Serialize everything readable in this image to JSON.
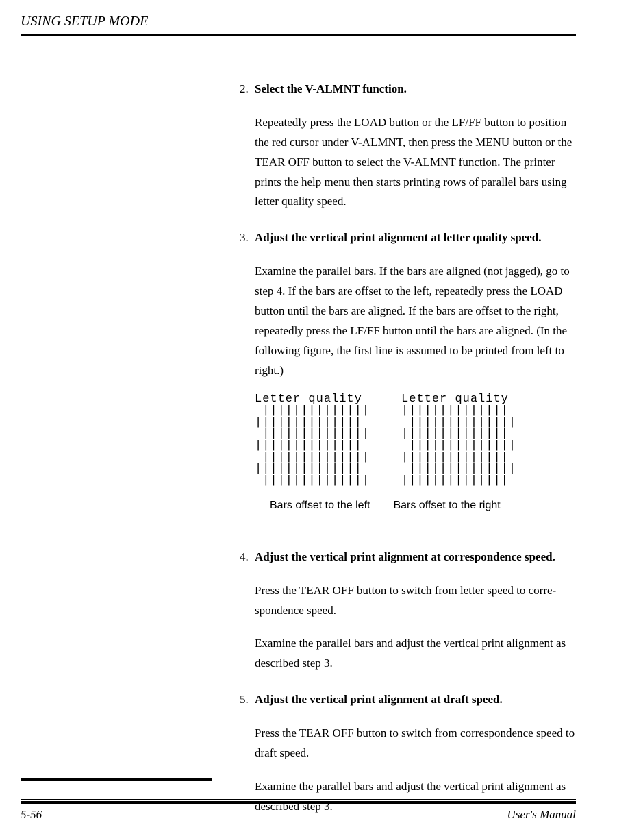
{
  "header": "USING SETUP MODE",
  "steps": [
    {
      "num": "2.",
      "title": "Select the V-ALMNT function.",
      "paras": [
        "Repeatedly press the LOAD button or the LF/FF button to position the red cursor under V-ALMNT, then press the MENU button or the TEAR OFF button to select the V-ALMNT function.  The printer prints the help menu then starts printing rows of parallel bars using letter quality speed."
      ]
    },
    {
      "num": "3.",
      "title": "Adjust the vertical print alignment at letter quality speed.",
      "paras": [
        "Examine the parallel bars.  If the bars are aligned (not jagged), go to step 4.  If the bars are offset to the left, repeatedly press the LOAD button until the bars are aligned.  If the bars are offset to the right, repeatedly press the LF/FF button until the bars are aligned.  (In the following figure, the first line is assumed to be printed from left to right.)"
      ]
    },
    {
      "num": "4.",
      "title": "Adjust the vertical print alignment at correspondence speed.",
      "paras": [
        "Press the TEAR OFF button to switch from letter speed to corre-spondence speed.",
        "Examine the parallel bars and adjust the vertical print alignment as described step 3."
      ]
    },
    {
      "num": "5.",
      "title": "Adjust the vertical print alignment at draft speed.",
      "paras": [
        "Press the TEAR OFF button to switch from correspondence speed to draft speed.",
        "Examine the parallel bars and adjust the vertical print alignment as described step 3."
      ]
    }
  ],
  "figure": {
    "left_label": "Letter quality",
    "right_label": "Letter quality",
    "left_caption": "Bars offset to the left",
    "right_caption": "Bars offset to the right"
  },
  "footer": {
    "page": "5-56",
    "manual": "User's Manual"
  }
}
